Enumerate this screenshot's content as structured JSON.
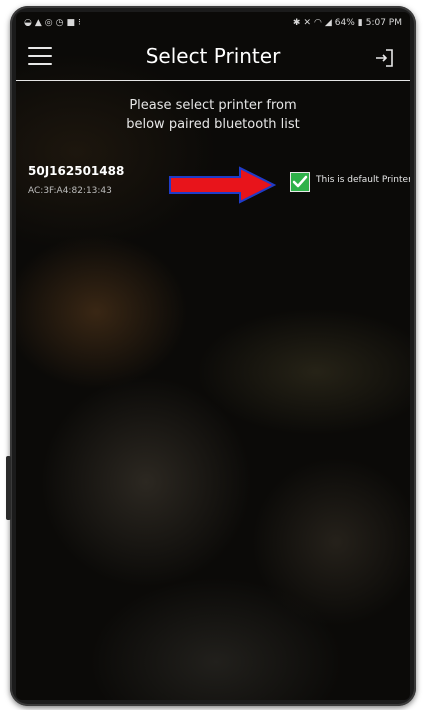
{
  "status_bar": {
    "left_icons": [
      "pin-icon",
      "warning-icon",
      "messenger-icon",
      "timer-icon",
      "image-icon",
      "notification-icon"
    ],
    "battery": "64%",
    "time": "5:07 PM"
  },
  "app_bar": {
    "title": "Select Printer",
    "menu_icon": "hamburger-menu-icon",
    "action_icon": "login-icon"
  },
  "instruction": {
    "line1": "Please select printer from",
    "line2": "below paired bluetooth list"
  },
  "printers": [
    {
      "name": "50J162501488",
      "mac": "AC:3F:A4:82:13:43",
      "default_checked": true,
      "default_label": "This is default Printer"
    }
  ],
  "colors": {
    "arrow_fill": "#e8141b",
    "arrow_outline": "#1f3cc9",
    "checkbox_fill": "#2fb14a"
  }
}
